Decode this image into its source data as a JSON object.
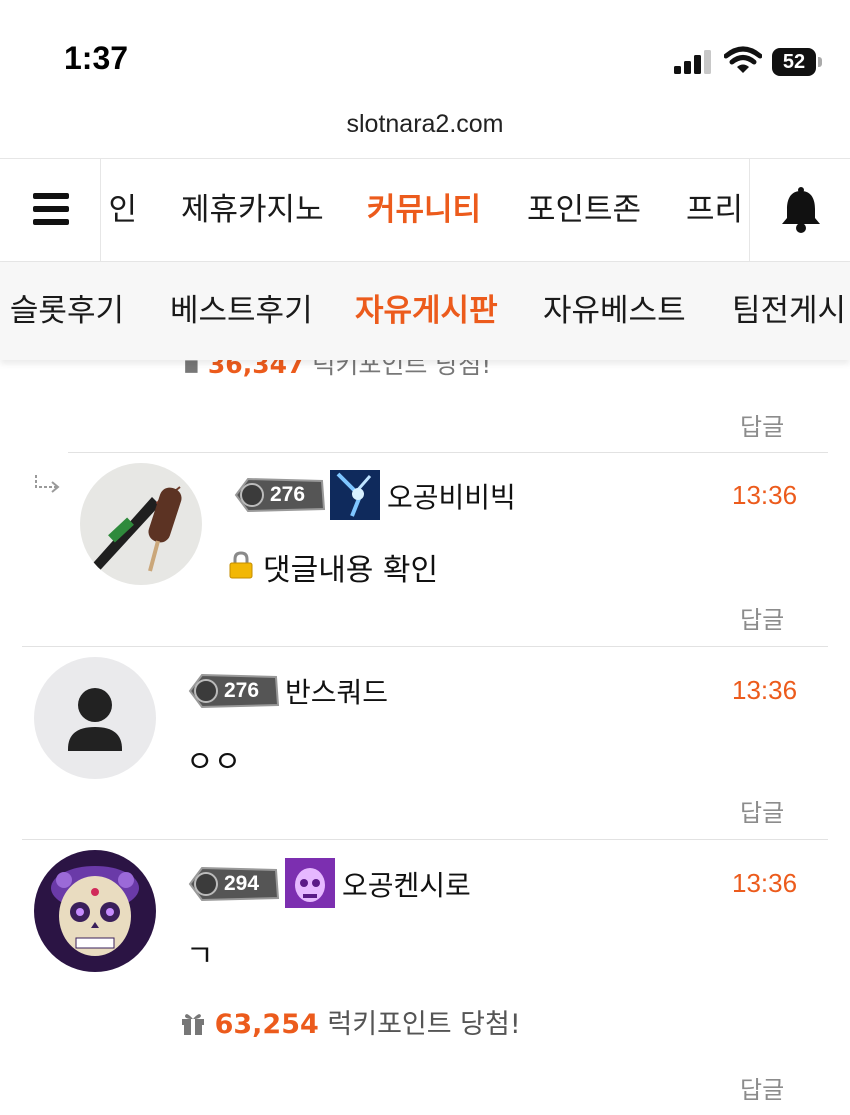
{
  "status_bar": {
    "time": "1:37",
    "battery": "52"
  },
  "browser": {
    "url": "slotnara2.com"
  },
  "main_nav": {
    "items": [
      {
        "label": "인"
      },
      {
        "label": "제휴카지노"
      },
      {
        "label": "커뮤니티",
        "active": true
      },
      {
        "label": "포인트존"
      },
      {
        "label": "프리"
      }
    ]
  },
  "sub_nav": {
    "items": [
      {
        "label": "슬롯후기"
      },
      {
        "label": "베스트후기"
      },
      {
        "label": "자유게시판",
        "active": true
      },
      {
        "label": "자유베스트"
      },
      {
        "label": "팀전게시"
      }
    ]
  },
  "peek": {
    "points": "36,347",
    "suffix": "럭키포인트 당첨!"
  },
  "reply_label": "답글",
  "comments": [
    {
      "level": "276",
      "username": "오공비비빅",
      "time": "13:36",
      "text": "댓글내용 확인",
      "is_reply": true,
      "secret": true
    },
    {
      "level": "276",
      "username": "반스쿼드",
      "time": "13:36",
      "text": "ㅇㅇ"
    },
    {
      "level": "294",
      "username": "오공켄시로",
      "time": "13:36",
      "text": "ㄱ",
      "lucky_points": "63,254",
      "lucky_suffix": "럭키포인트 당첨!"
    }
  ],
  "colors": {
    "accent": "#ec5b1c",
    "muted": "#8c8c8c",
    "divider": "#e2e2e2"
  },
  "icons": [
    "hamburger-icon",
    "bell-icon",
    "signal-icon",
    "wifi-icon",
    "battery-icon",
    "reply-arrow-icon",
    "lock-icon",
    "gift-icon",
    "default-avatar-icon"
  ]
}
